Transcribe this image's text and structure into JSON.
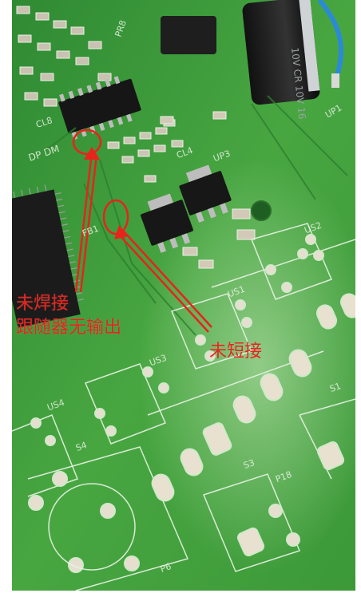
{
  "annotations": {
    "line1": "未焊接",
    "line2": "跟随器无输出",
    "line3": "未短接"
  },
  "silkscreen": {
    "dp_dm": "DP DM",
    "cl8": "CL8",
    "cl4": "CL4",
    "up3": "UP3",
    "fb1": "FB1",
    "us1": "US1",
    "us2": "US2",
    "us3": "US3",
    "us4": "US4",
    "s1": "S1",
    "s3": "S3",
    "s4": "S4",
    "p18": "P18",
    "p6": "P6",
    "up1": "UP1",
    "pr8": "PR8",
    "capacitor_text": "10V CR 10V 16"
  },
  "colors": {
    "annotation": "#e8231c",
    "board": "#3f9a3c",
    "silkscreen": "#e9f3e6"
  }
}
